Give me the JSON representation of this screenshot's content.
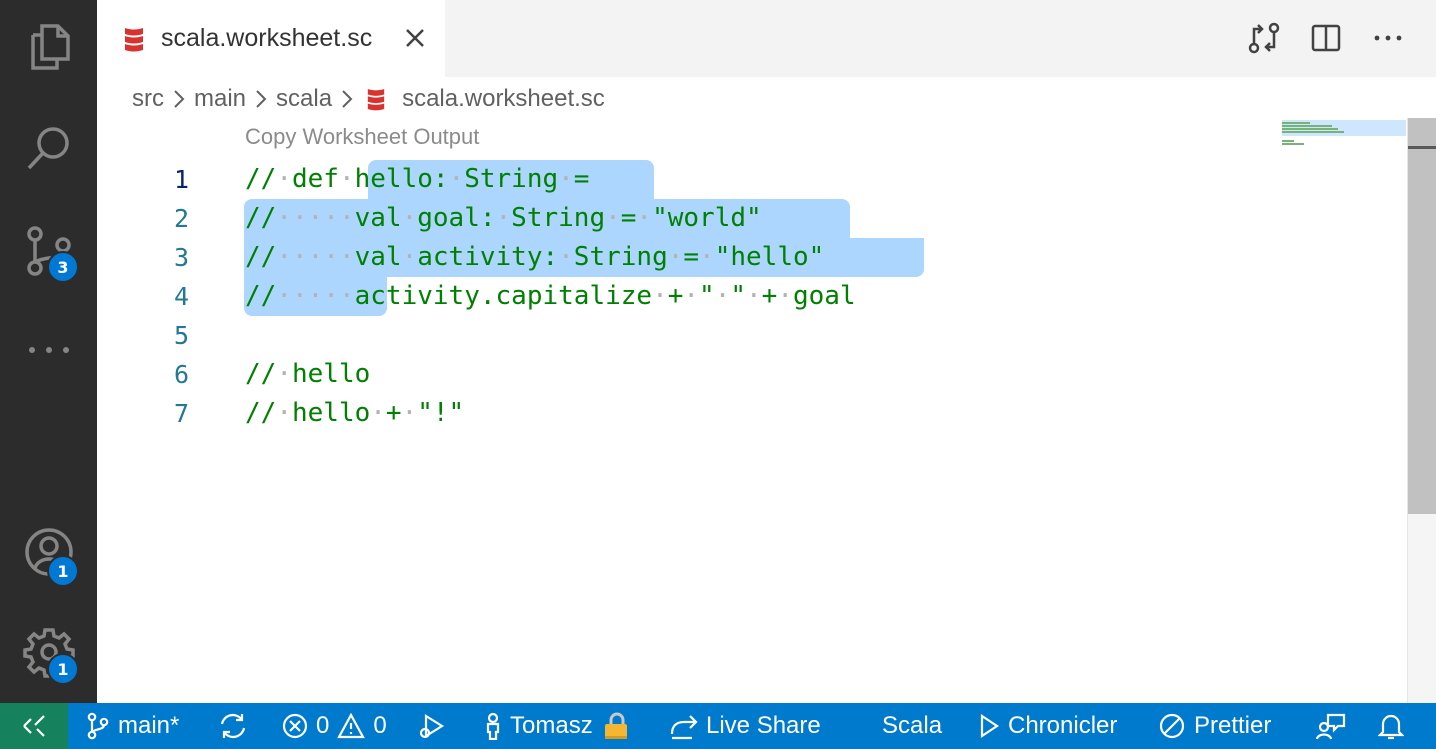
{
  "activity_bar": {
    "icons": [
      "files-icon",
      "search-icon",
      "source-control-icon",
      "more-icon",
      "accounts-icon",
      "manage-gear-icon"
    ],
    "badges": {
      "source_control": "3",
      "accounts": "1",
      "manage": "1"
    }
  },
  "tab": {
    "title": "scala.worksheet.sc",
    "file_icon": "scala-icon",
    "close_icon": "close-icon"
  },
  "editor_actions": [
    "open-changes-icon",
    "split-editor-icon",
    "more-actions-icon"
  ],
  "breadcrumb": {
    "items": [
      "src",
      "main",
      "scala"
    ],
    "file": "scala.worksheet.sc"
  },
  "editor": {
    "codelens": "Copy Worksheet Output",
    "lines": [
      {
        "number": "1",
        "text": "// def hello: String ="
      },
      {
        "number": "2",
        "text": "//     val goal: String = \"world\""
      },
      {
        "number": "3",
        "text": "//     val activity: String = \"hello\""
      },
      {
        "number": "4",
        "text": "//     activity.capitalize + \" \" + goal"
      },
      {
        "number": "5",
        "text": ""
      },
      {
        "number": "6",
        "text": "// hello"
      },
      {
        "number": "7",
        "text": "// hello + \"!\""
      }
    ]
  },
  "status_bar": {
    "branch": "main*",
    "errors": "0",
    "warnings": "0",
    "user": "Tomasz",
    "live_share": "Live Share",
    "language": "Scala",
    "chronicler": "Chronicler",
    "prettier": "Prettier"
  },
  "colors": {
    "activity_bar": "#2c2c2c",
    "status_bar": "#007acc",
    "remote": "#16825d",
    "comment": "#008000",
    "selection": "#add6ff",
    "badge": "#0078d4"
  }
}
